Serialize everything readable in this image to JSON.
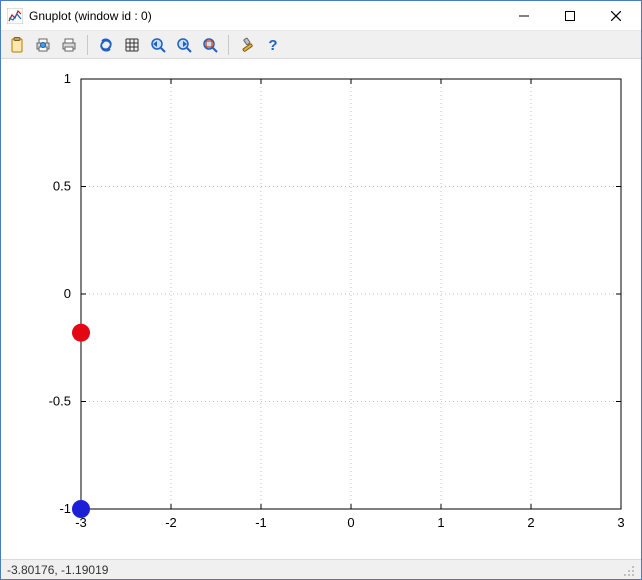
{
  "window": {
    "title": "Gnuplot (window id : 0)"
  },
  "toolbar": {
    "items": [
      "clipboard",
      "print",
      "export",
      "refresh",
      "grid",
      "zoom-prev",
      "zoom-next",
      "autoscale",
      "options",
      "help"
    ]
  },
  "chart_data": {
    "type": "scatter",
    "xlim": [
      -3,
      3
    ],
    "ylim": [
      -1,
      1
    ],
    "xticks": [
      -3,
      -2,
      -1,
      0,
      1,
      2,
      3
    ],
    "yticks": [
      -1,
      -0.5,
      0,
      0.5,
      1
    ],
    "series": [
      {
        "name": "red",
        "color": "#e30613",
        "points": [
          {
            "x": -3,
            "y": -0.18
          }
        ]
      },
      {
        "name": "blue",
        "color": "#1c1fd6",
        "points": [
          {
            "x": -3,
            "y": -1.0
          }
        ]
      }
    ],
    "grid": true
  },
  "statusbar": {
    "coords": "-3.80176, -1.19019"
  }
}
